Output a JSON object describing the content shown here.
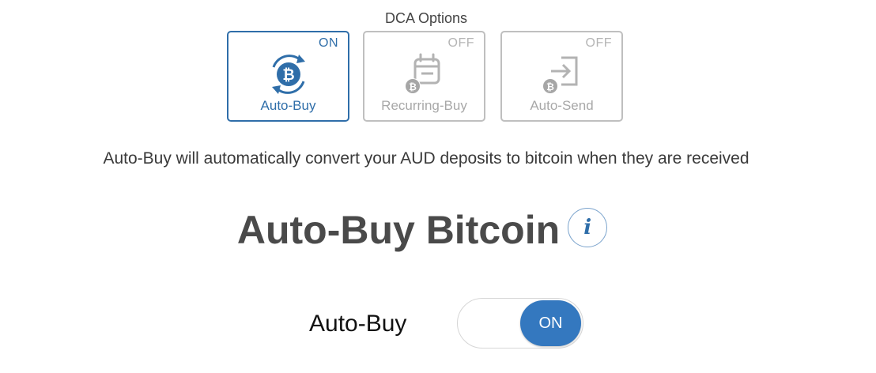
{
  "dca": {
    "title": "DCA Options",
    "options": [
      {
        "label": "Auto-Buy",
        "status": "ON",
        "icon": "bitcoin-refresh-icon"
      },
      {
        "label": "Recurring-Buy",
        "status": "OFF",
        "icon": "calendar-bitcoin-icon"
      },
      {
        "label": "Auto-Send",
        "status": "OFF",
        "icon": "send-bitcoin-icon"
      }
    ]
  },
  "description": "Auto-Buy will automatically convert your AUD deposits to bitcoin when they are received",
  "section": {
    "heading": "Auto-Buy Bitcoin",
    "info_symbol": "i"
  },
  "toggle": {
    "label": "Auto-Buy",
    "state": "ON"
  },
  "colors": {
    "accent": "#2f6ea9",
    "toggle_on": "#3478bf",
    "inactive": "#bfbfbf"
  }
}
